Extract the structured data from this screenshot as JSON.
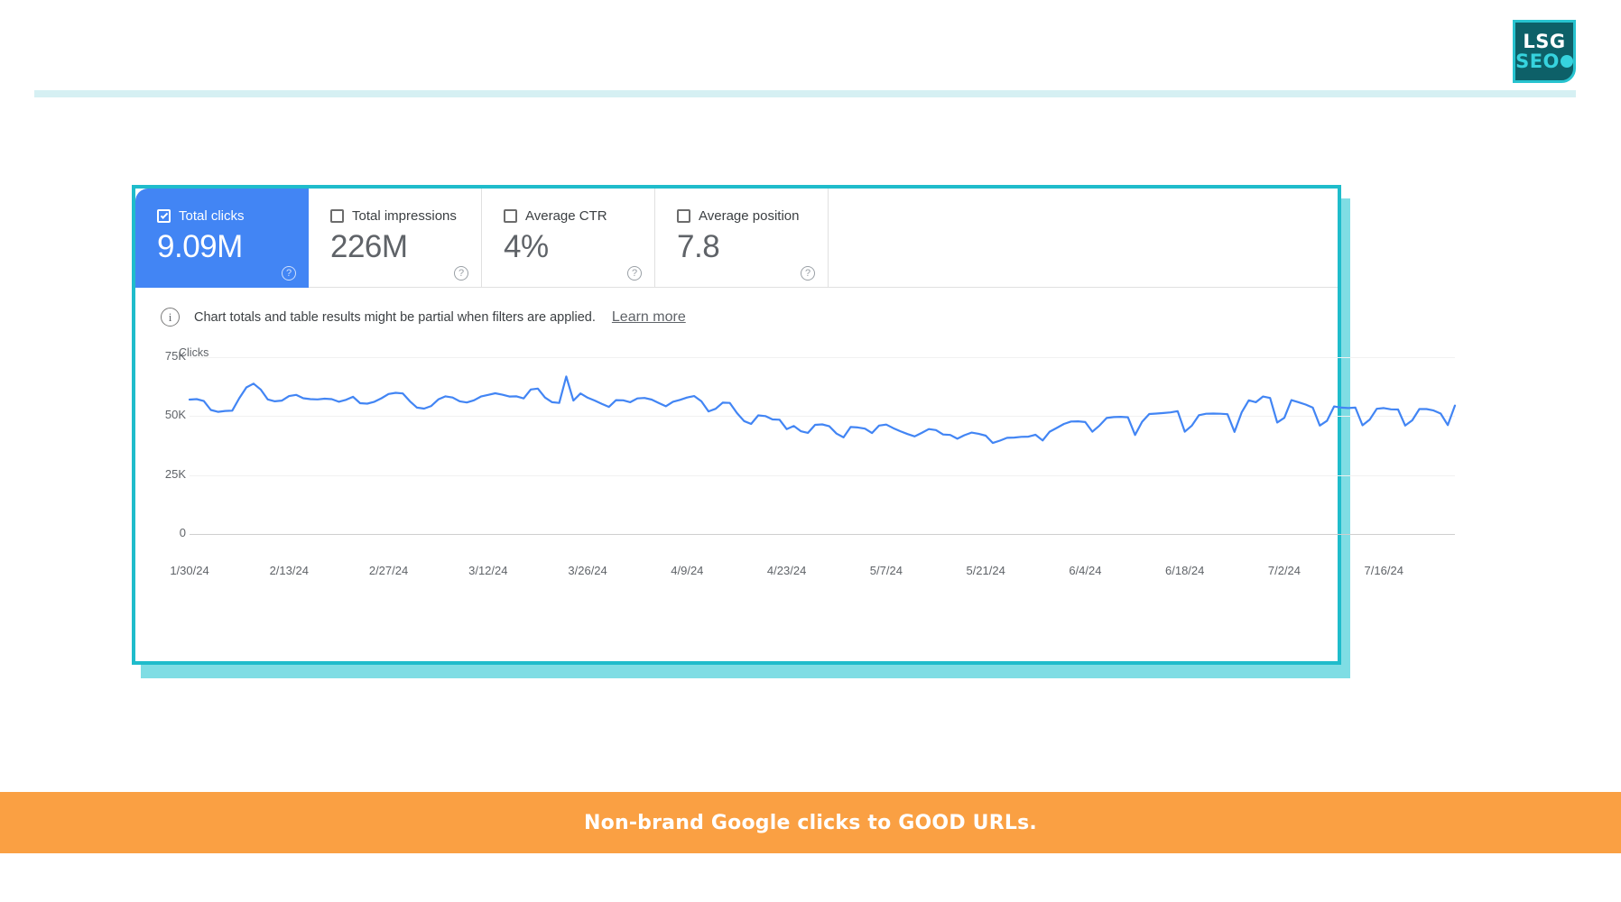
{
  "logo": {
    "top_text": "LSG",
    "bottom_text": "SEO",
    "border_color": "#27c3cf",
    "fill_color": "#0d6068"
  },
  "card": {
    "border_color": "#1fbccb",
    "shadow_color": "#7fdde4"
  },
  "metrics": [
    {
      "label": "Total clicks",
      "value": "9.09M",
      "checked": true,
      "help": "?"
    },
    {
      "label": "Total impressions",
      "value": "226M",
      "checked": false,
      "help": "?"
    },
    {
      "label": "Average CTR",
      "value": "4%",
      "checked": false,
      "help": "?"
    },
    {
      "label": "Average position",
      "value": "7.8",
      "checked": false,
      "help": "?"
    }
  ],
  "banner": {
    "icon": "info-icon",
    "text": "Chart totals and table results might be partial when filters are applied.",
    "link_label": "Learn more"
  },
  "footer": {
    "text": "Non-brand Google clicks to GOOD URLs."
  },
  "chart_data": {
    "type": "line",
    "title": "",
    "ylabel": "Clicks",
    "xlabel": "",
    "ylim": [
      0,
      75000
    ],
    "ytick_labels": [
      "75K",
      "50K",
      "25K",
      "0"
    ],
    "ytick_values": [
      75000,
      50000,
      25000,
      0
    ],
    "grid": true,
    "legend": false,
    "line_color": "#4285f4",
    "xtick_labels": [
      "1/30/24",
      "2/13/24",
      "2/27/24",
      "3/12/24",
      "3/26/24",
      "4/9/24",
      "4/23/24",
      "5/7/24",
      "5/21/24",
      "6/4/24",
      "6/18/24",
      "7/2/24",
      "7/16/24"
    ],
    "xtick_indices": [
      0,
      14,
      28,
      42,
      56,
      70,
      84,
      98,
      112,
      126,
      140,
      154,
      168
    ],
    "series": [
      {
        "name": "Clicks",
        "values": [
          57000,
          57200,
          56400,
          52600,
          51800,
          52200,
          52300,
          57600,
          62200,
          63800,
          61300,
          57100,
          56300,
          56600,
          58500,
          59000,
          57600,
          57200,
          57100,
          57400,
          57200,
          56100,
          56900,
          58200,
          55500,
          55300,
          56100,
          57600,
          59400,
          59900,
          59600,
          56300,
          53600,
          53200,
          54300,
          57100,
          58400,
          57900,
          56300,
          55800,
          56700,
          58300,
          59000,
          59700,
          59100,
          58300,
          58400,
          57500,
          61300,
          61700,
          57900,
          55900,
          55600,
          66800,
          56600,
          59600,
          57800,
          56600,
          55200,
          53900,
          56800,
          56700,
          55900,
          57500,
          57700,
          57000,
          55600,
          54200,
          56100,
          56900,
          57900,
          58500,
          56300,
          52000,
          53100,
          55700,
          55600,
          51300,
          47900,
          46700,
          50300,
          50000,
          48600,
          48500,
          44500,
          45800,
          43600,
          42900,
          46300,
          46500,
          45700,
          42600,
          41000,
          45400,
          45200,
          44700,
          42800,
          46000,
          46400,
          44900,
          43600,
          42400,
          41400,
          42900,
          44500,
          44100,
          42200,
          42000,
          40400,
          41900,
          43000,
          42500,
          41700,
          38600,
          39600,
          40800,
          40900,
          41200,
          41300,
          42100,
          39700,
          43400,
          45000,
          46700,
          47700,
          47800,
          47500,
          43400,
          46000,
          49200,
          49600,
          49700,
          49500,
          42000,
          47600,
          50900,
          51100,
          51300,
          51600,
          52100,
          43400,
          46000,
          50400,
          51000,
          51100,
          51000,
          50800,
          43300,
          51600,
          56700,
          55900,
          58300,
          57700,
          47300,
          49300,
          56800,
          55900,
          54900,
          53600,
          46000,
          48000,
          54100,
          53600,
          53400,
          53600,
          46100,
          48500,
          53100,
          53400,
          52900,
          52800,
          46000,
          48200,
          53000,
          53000,
          52400,
          51100,
          46200,
          54500
        ]
      }
    ]
  }
}
